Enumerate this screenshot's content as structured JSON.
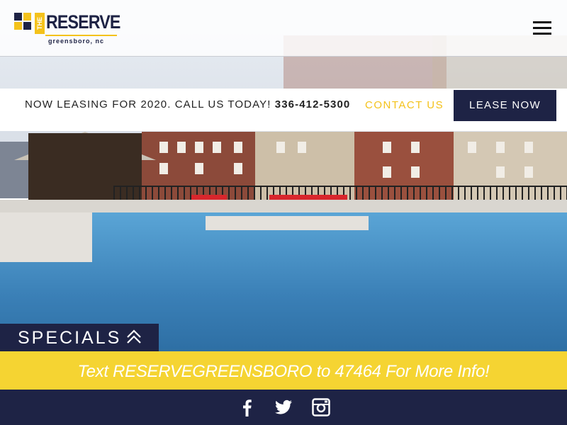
{
  "brand": {
    "logo_the": "THE",
    "logo_name": "RESERVE",
    "logo_city": "greensboro, nc",
    "navy": "#1e2345",
    "yellow": "#f4c21b"
  },
  "header": {
    "menu_icon": "hamburger-menu-icon"
  },
  "leasing": {
    "announcement": "NOW LEASING FOR 2020. CALL US TODAY!",
    "phone": "336-412-5300",
    "contact_label": "CONTACT US",
    "lease_now_label": "LEASE NOW"
  },
  "specials": {
    "label": "SPECIALS",
    "icon": "double-chevron-up-icon"
  },
  "text_banner": {
    "message": "Text RESERVEGREENSBORO to 47464 For More Info!"
  },
  "footer": {
    "social": [
      {
        "icon": "facebook-icon"
      },
      {
        "icon": "twitter-icon"
      },
      {
        "icon": "instagram-icon"
      }
    ]
  }
}
